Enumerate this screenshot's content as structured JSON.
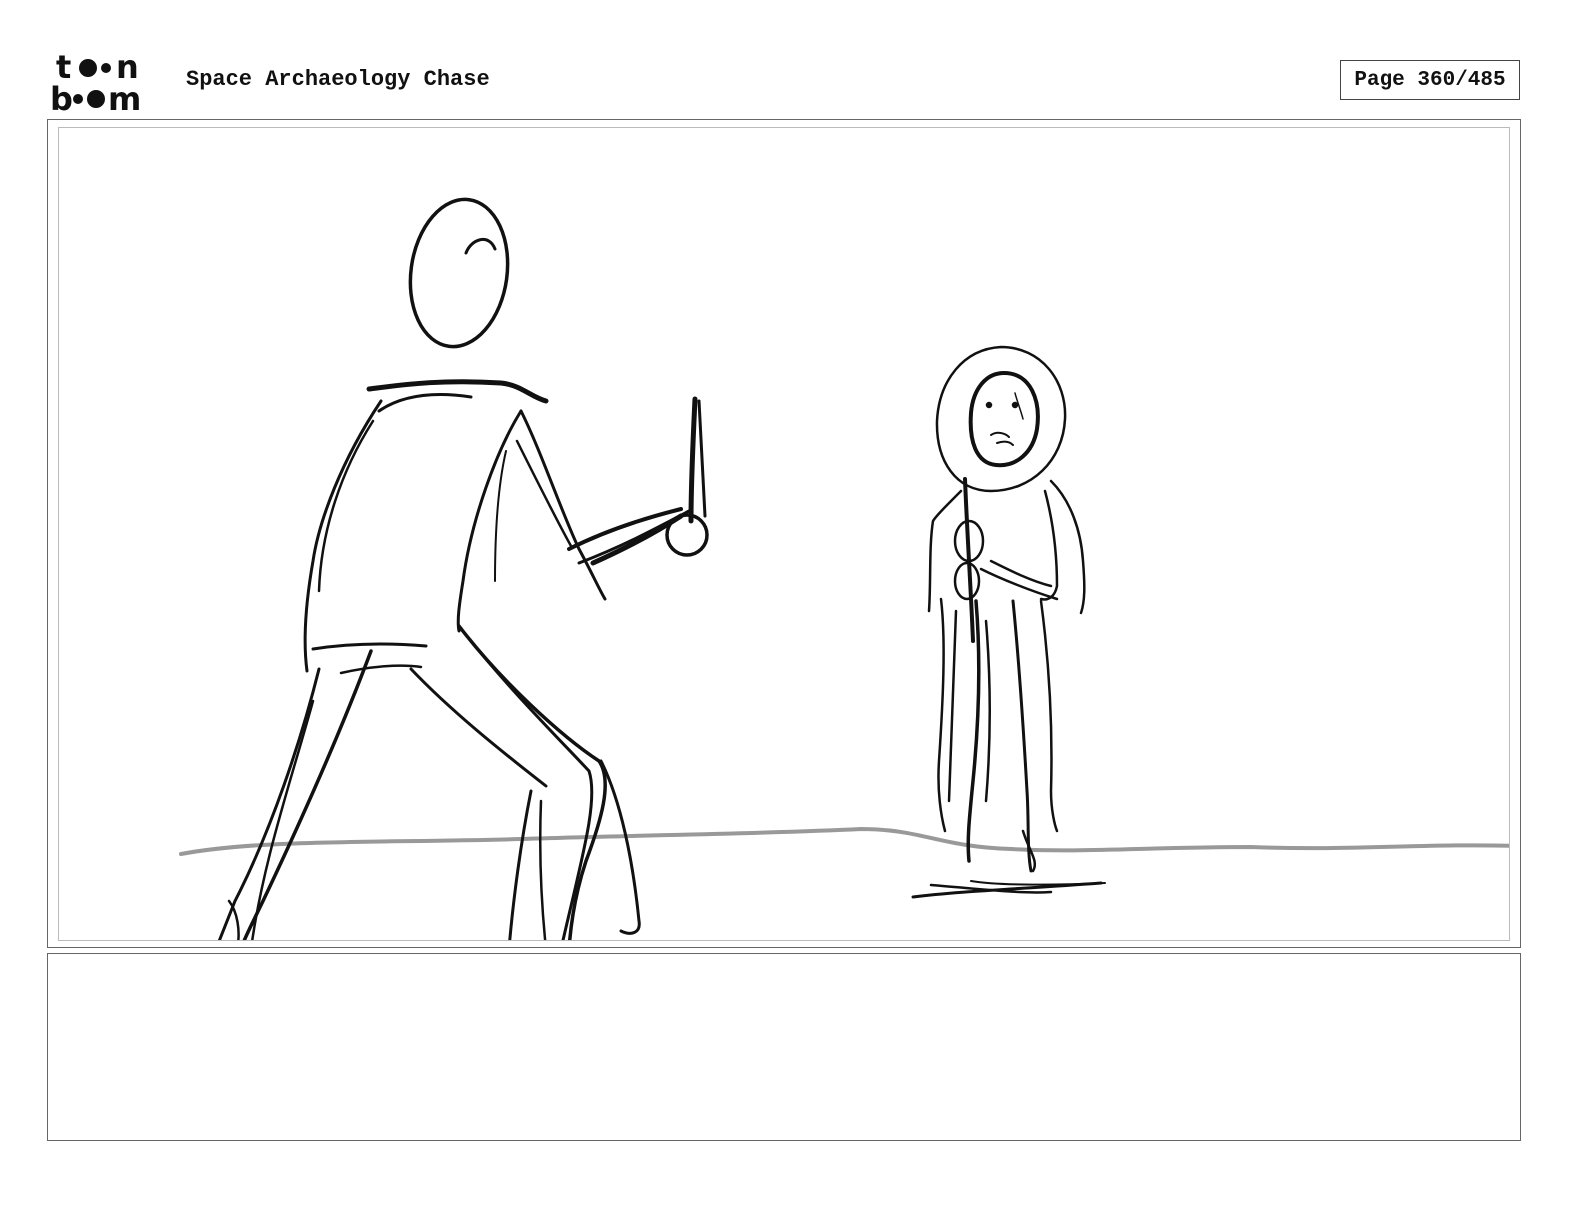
{
  "header": {
    "logo_line1": "toon",
    "logo_line2": "boom",
    "title": "Space Archaeology Chase",
    "page_label": "Page 360/485"
  },
  "panel": {
    "notes": ""
  },
  "colors": {
    "ink": "#111111",
    "ground_line": "#999999",
    "frame": "#666666"
  }
}
